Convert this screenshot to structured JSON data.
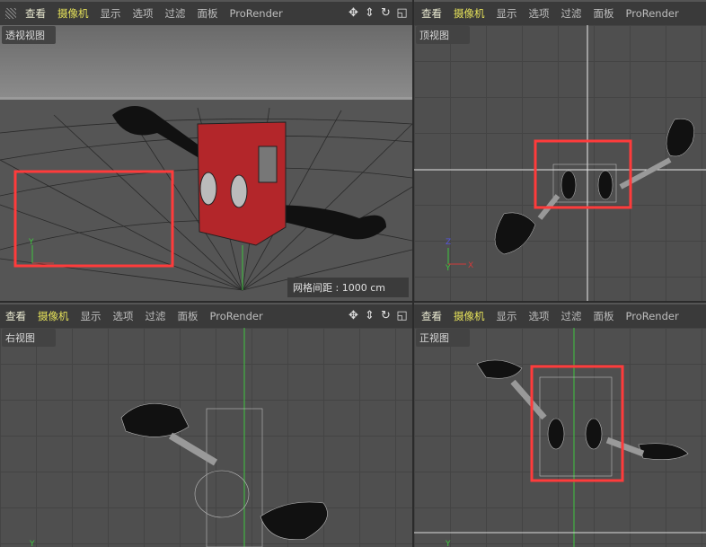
{
  "menu": [
    "查看",
    "摄像机",
    "显示",
    "选项",
    "过滤",
    "面板",
    "ProRender"
  ],
  "nav_icons": [
    "move-icon",
    "zoom-arrow-icon",
    "rotate-icon",
    "maximize-viewport-icon"
  ],
  "viewports": [
    {
      "name": "透视视图",
      "grid_spacing": "网格间距 : 1000 cm"
    },
    {
      "name": "顶视图"
    },
    {
      "name": "右视图"
    },
    {
      "name": "正视图"
    }
  ],
  "axes": {
    "x": "X",
    "y": "Y",
    "z": "Z"
  },
  "colors": {
    "highlight": "#ff3b3b",
    "menu_active": "#e6e25a",
    "x_axis": "#d23b3b",
    "y_axis": "#3fc43f",
    "z_axis": "#5555dd"
  }
}
